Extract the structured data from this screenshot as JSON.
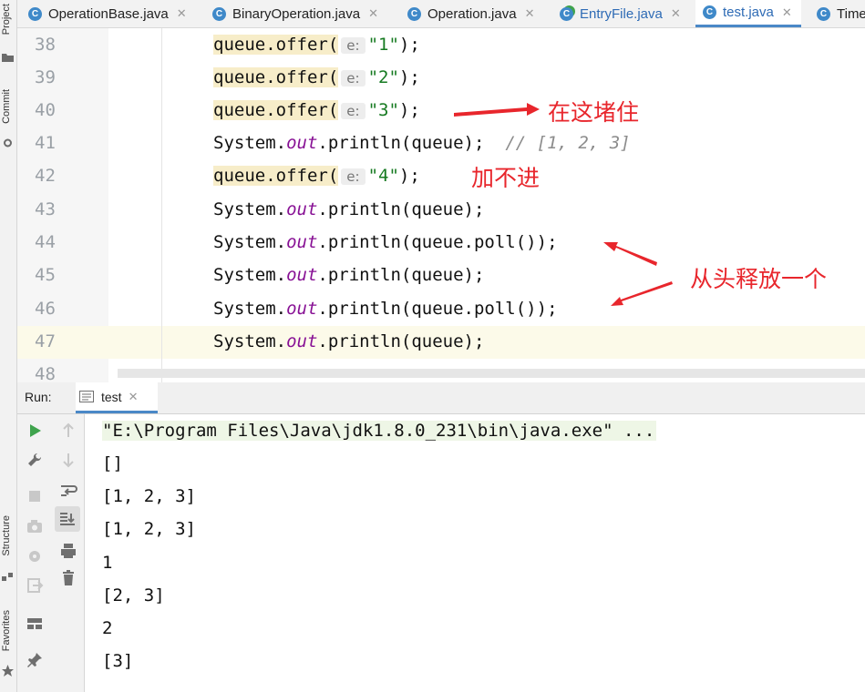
{
  "side_labels": {
    "project": "Project",
    "commit": "Commit",
    "structure": "Structure",
    "favorites": "Favorites"
  },
  "tabs": [
    {
      "label": "OperationBase.java",
      "icon": "class-icon",
      "active": false
    },
    {
      "label": "BinaryOperation.java",
      "icon": "class-icon",
      "active": false
    },
    {
      "label": "Operation.java",
      "icon": "class-icon",
      "active": false
    },
    {
      "label": "EntryFile.java",
      "icon": "runnable-class-icon",
      "active": false
    },
    {
      "label": "test.java",
      "icon": "class-icon",
      "active": true
    },
    {
      "label": "Time",
      "icon": "class-icon",
      "active": false
    }
  ],
  "editor": {
    "line_numbers": [
      "38",
      "39",
      "40",
      "41",
      "42",
      "43",
      "44",
      "45",
      "46",
      "47",
      "48"
    ],
    "lines": [
      {
        "parts": [
          "queue.offer(",
          "e:",
          "\"1\"",
          ");"
        ]
      },
      {
        "parts": [
          "queue.offer(",
          "e:",
          "\"2\"",
          ");"
        ]
      },
      {
        "parts": [
          "queue.offer(",
          "e:",
          "\"3\"",
          ");"
        ]
      },
      {
        "parts": [
          "System.",
          "out",
          ".println(queue);",
          "  // [1, 2, 3]"
        ]
      },
      {
        "parts": [
          "queue.offer(",
          "e:",
          "\"4\"",
          ");"
        ]
      },
      {
        "parts": [
          "System.",
          "out",
          ".println(queue);"
        ]
      },
      {
        "parts": [
          "System.",
          "out",
          ".println(queue.poll());"
        ]
      },
      {
        "parts": [
          "System.",
          "out",
          ".println(queue);"
        ]
      },
      {
        "parts": [
          "System.",
          "out",
          ".println(queue.poll());"
        ]
      },
      {
        "parts": [
          "System.",
          "out",
          ".println(queue);"
        ]
      }
    ],
    "annotations": {
      "blocked": "在这堵住",
      "cannot_add": "加不进",
      "release_from_head": "从头释放一个"
    }
  },
  "run": {
    "label": "Run:",
    "tab": "test",
    "output": [
      "\"E:\\Program Files\\Java\\jdk1.8.0_231\\bin\\java.exe\" ...",
      "[]",
      "[1, 2, 3]",
      "[1, 2, 3]",
      "1",
      "[2, 3]",
      "2",
      "[3]"
    ]
  },
  "colors": {
    "accent": "#4a88c7",
    "annotation_red": "#e8262c",
    "keyword": "#871094",
    "string": "#167a21"
  }
}
